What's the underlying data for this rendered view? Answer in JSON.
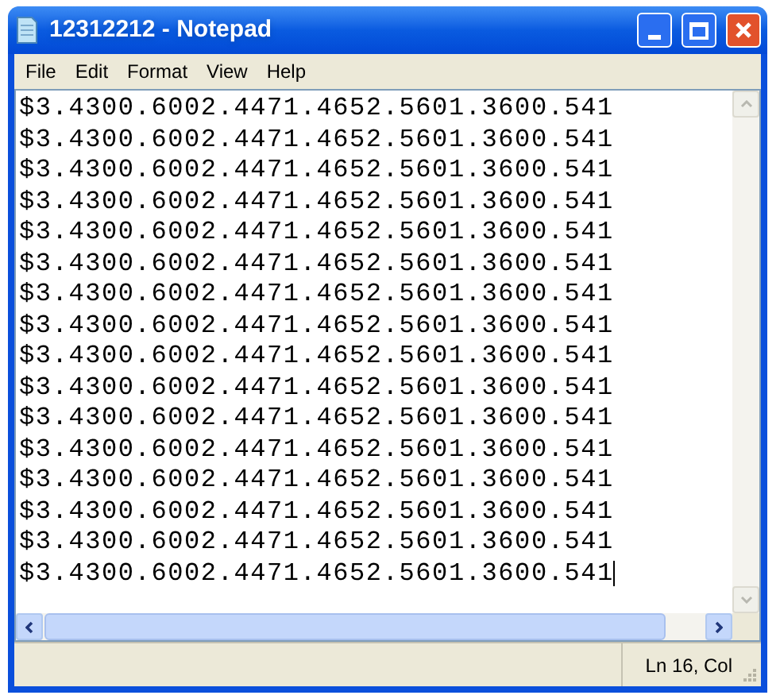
{
  "window": {
    "title": "12312212 - Notepad"
  },
  "menu": [
    "File",
    "Edit",
    "Format",
    "View",
    "Help"
  ],
  "lines": [
    "$3.4300.6002.4471.4652.5601.3600.541",
    "$3.4300.6002.4471.4652.5601.3600.541",
    "$3.4300.6002.4471.4652.5601.3600.541",
    "$3.4300.6002.4471.4652.5601.3600.541",
    "$3.4300.6002.4471.4652.5601.3600.541",
    "$3.4300.6002.4471.4652.5601.3600.541",
    "$3.4300.6002.4471.4652.5601.3600.541",
    "$3.4300.6002.4471.4652.5601.3600.541",
    "$3.4300.6002.4471.4652.5601.3600.541",
    "$3.4300.6002.4471.4652.5601.3600.541",
    "$3.4300.6002.4471.4652.5601.3600.541",
    "$3.4300.6002.4471.4652.5601.3600.541",
    "$3.4300.6002.4471.4652.5601.3600.541",
    "$3.4300.6002.4471.4652.5601.3600.541",
    "$3.4300.6002.4471.4652.5601.3600.541",
    "$3.4300.6002.4471.4652.5601.3600.541"
  ],
  "status_bar": {
    "position": "Ln 16, Col"
  }
}
